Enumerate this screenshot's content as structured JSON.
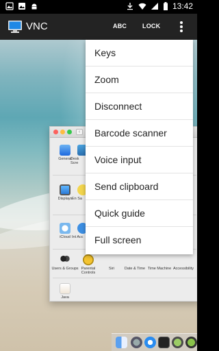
{
  "status_bar": {
    "time": "13:42",
    "icons": [
      "image-icon",
      "photo-icon",
      "android-icon",
      "download-icon",
      "wifi-icon",
      "cell-signal-icon",
      "battery-icon"
    ]
  },
  "app_bar": {
    "title": "VNC",
    "abc_label": "ABC",
    "lock_label": "LOCK",
    "icon": "monitor-icon"
  },
  "menu": {
    "items": [
      {
        "label": "Keys"
      },
      {
        "label": "Zoom"
      },
      {
        "label": "Disconnect"
      },
      {
        "label": "Barcode scanner"
      },
      {
        "label": "Voice input"
      },
      {
        "label": "Send clipboard"
      },
      {
        "label": "Quick guide"
      },
      {
        "label": "Full screen"
      }
    ]
  },
  "prefs": {
    "items": [
      {
        "label": "General"
      },
      {
        "label": "Desk Scre"
      },
      {
        "label": "Displays"
      },
      {
        "label": "En Sa"
      },
      {
        "label": "iCloud"
      },
      {
        "label": "Int Acc"
      },
      {
        "label": "Users & Groups"
      },
      {
        "label": "Parental Controls"
      },
      {
        "label": "Siri"
      },
      {
        "label": "Date & Time"
      },
      {
        "label": "Time Machine"
      },
      {
        "label": "Accessibility"
      },
      {
        "label": "Java"
      }
    ]
  },
  "colors": {
    "app_bar": "#232323",
    "status_bar": "#000000",
    "menu_bg": "#ffffff"
  }
}
